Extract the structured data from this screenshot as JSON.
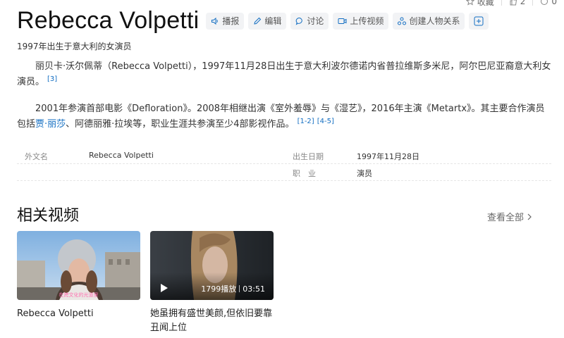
{
  "top_bar": {
    "collect_label": "收藏",
    "like_count": "2",
    "share_count": "0"
  },
  "header": {
    "title": "Rebecca Volpetti",
    "actions": [
      {
        "label": "播报",
        "icon": "speaker-icon"
      },
      {
        "label": "编辑",
        "icon": "pencil-icon"
      },
      {
        "label": "讨论",
        "icon": "chat-icon"
      },
      {
        "label": "上传视频",
        "icon": "video-icon"
      },
      {
        "label": "创建人物关系",
        "icon": "relation-icon"
      }
    ],
    "add_icon": "plus-square-icon"
  },
  "subtitle": "1997年出生于意大利的女演员",
  "para1": {
    "text": "丽贝卡·沃尔佩蒂（Rebecca Volpetti），1997年11月28日出生于意大利波尔德诺内省普拉维斯多米尼，阿尔巴尼亚裔意大利女演员。",
    "ref": "[3]"
  },
  "para2": {
    "text_before": "2001年参演首部电影《Defloration》。2008年相继出演《室外羞辱》与《湿艺》，2016年主演《Metartx》。其主要合作演员包括",
    "link": "贾·丽莎",
    "text_after": "、阿德丽雅·拉埃等，职业生涯共参演至少4部影视作品。",
    "ref1": "[1-2]",
    "ref2": "[4-5]"
  },
  "info": {
    "row1": {
      "k1": "外文名",
      "v1": "Rebecca Volpetti",
      "k2": "出生日期",
      "v2": "1997年11月28日"
    },
    "row2": {
      "k2": "职　业",
      "v2": "演员"
    }
  },
  "videos": {
    "section_title": "相关视频",
    "view_all": "查看全部",
    "items": [
      {
        "title": "Rebecca Volpetti",
        "overlay_caption": "在跨文化的光道里"
      },
      {
        "title": "她虽拥有盛世美颜,但依旧要靠丑闻上位",
        "plays": "1799播放",
        "duration": "03:51"
      }
    ]
  },
  "colors": {
    "link": "#136ec2",
    "button_bg": "#f2f3f5"
  }
}
